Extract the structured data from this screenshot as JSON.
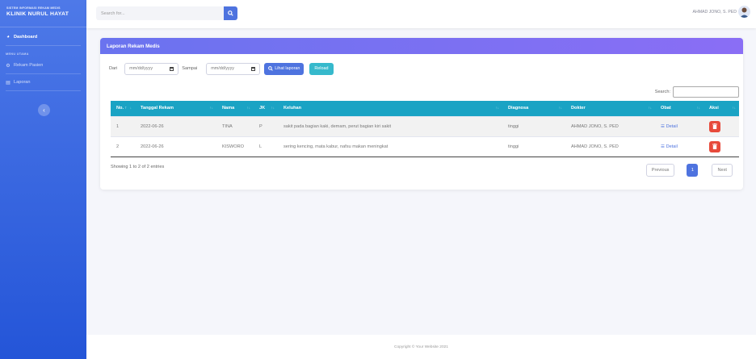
{
  "sidebar": {
    "brand_sub": "SISTEM INFORMASI REKAM MEDIS",
    "brand_main": "KLINIK NURUL HAYAT",
    "dashboard": "Dashboard",
    "heading": "MENU UTAMA",
    "rekam": "Rekam Pasien",
    "laporan": "Laporan"
  },
  "topbar": {
    "search_placeholder": "Search for...",
    "user": "AHMAD JONO, S. PED"
  },
  "card": {
    "title": "Laporan Rekam Medis",
    "dari": "Dari",
    "sampai": "Sampai",
    "date_placeholder": "mm/dd/yyyy",
    "lihat": "Lihat laporan",
    "reload": "Reload",
    "search_label": "Search:"
  },
  "table": {
    "headers": [
      "No.",
      "Tanggal Rekam",
      "Nama",
      "JK",
      "Keluhan",
      "Diagnosa",
      "Dokter",
      "Obat",
      "Aksi"
    ],
    "rows": [
      {
        "no": "1",
        "tanggal": "2022-06-26",
        "nama": "TINA",
        "jk": "P",
        "keluhan": "sakit pada bagian kaki, demam, perut bagian kiri sakit",
        "diagnosa": "tinggi",
        "dokter": "AHMAD JONO, S. PED",
        "obat": "Detail"
      },
      {
        "no": "2",
        "tanggal": "2022-06-26",
        "nama": "KISWORO",
        "jk": "L",
        "keluhan": "sering kencing, mata kabur, nafsu makan meningkat",
        "diagnosa": "tinggi",
        "dokter": "AHMAD JONO, S. PED",
        "obat": "Detail"
      }
    ]
  },
  "pagination": {
    "info": "Showing 1 to 2 of 2 entries",
    "previous": "Previous",
    "current": "1",
    "next": "Next"
  },
  "footer": "Copyright © Your Website 2021",
  "colors": {
    "primary": "#4e73df",
    "info": "#36b9cc",
    "danger": "#e74a3b",
    "table_head": "#1aa3c4"
  }
}
